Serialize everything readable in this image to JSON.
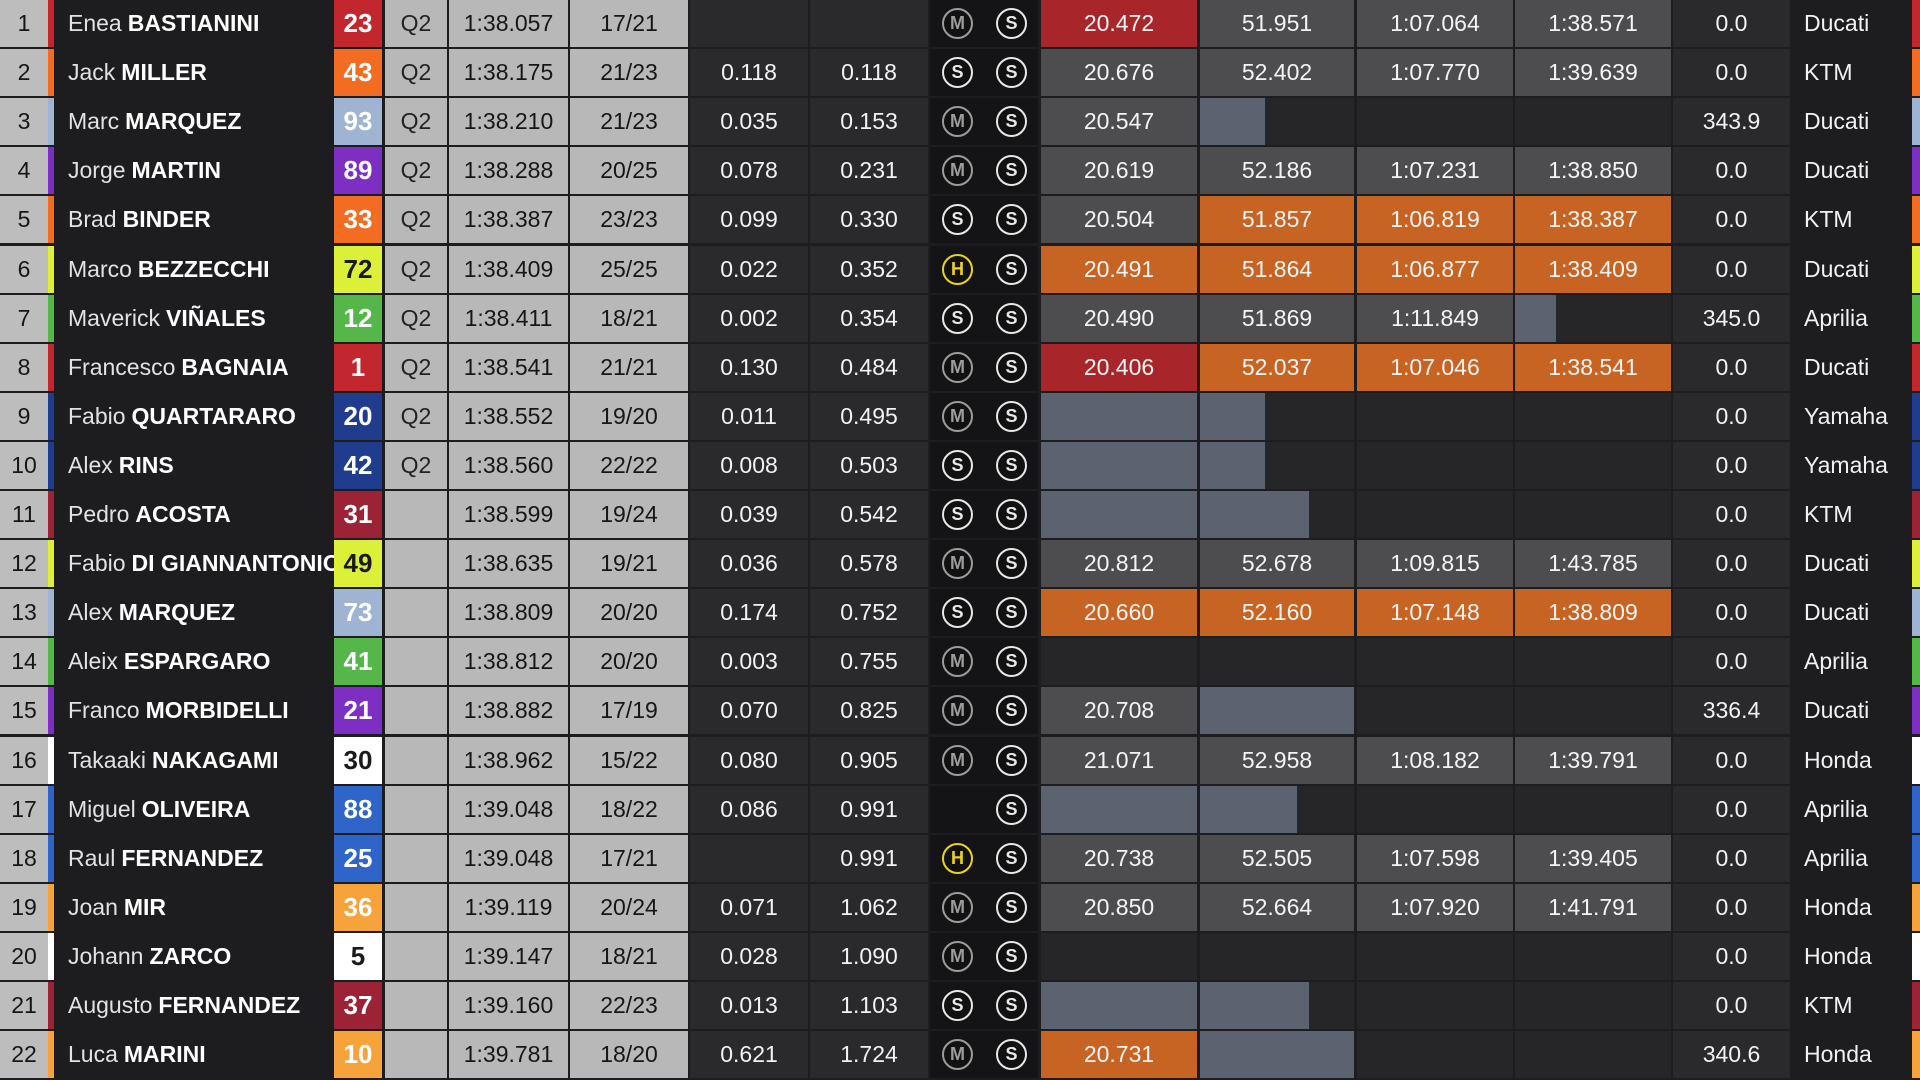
{
  "colors": {
    "best_overall_sector": "#a8262a",
    "personal_best_sector": "#c76423",
    "regular_sector": "#4d4d50",
    "in_progress_sector": "#5b6270"
  },
  "rows": [
    {
      "pos": "1",
      "first": "Enea",
      "last": "BASTIANINI",
      "number": "23",
      "num_bg": "#c1272d",
      "num_fg": "#ffffff",
      "team_color": "#c1272d",
      "q": "Q2",
      "best": "1:38.057",
      "laps": "17/21",
      "gap": "",
      "ldr": "",
      "tyre_front": "M",
      "tyre_rear": "S",
      "s1": {
        "v": "20.472",
        "k": "best-overall"
      },
      "s2": {
        "v": "51.951",
        "k": "regular"
      },
      "s3": {
        "v": "1:07.064",
        "k": "regular"
      },
      "s4": {
        "v": "1:38.571",
        "k": "regular"
      },
      "speed": "0.0",
      "team": "Ducati"
    },
    {
      "pos": "2",
      "first": "Jack",
      "last": "MILLER",
      "number": "43",
      "num_bg": "#f26d21",
      "num_fg": "#ffffff",
      "team_color": "#f26d21",
      "q": "Q2",
      "best": "1:38.175",
      "laps": "21/23",
      "gap": "0.118",
      "ldr": "0.118",
      "tyre_front": "S",
      "tyre_rear": "S",
      "s1": {
        "v": "20.676",
        "k": "regular"
      },
      "s2": {
        "v": "52.402",
        "k": "regular"
      },
      "s3": {
        "v": "1:07.770",
        "k": "regular"
      },
      "s4": {
        "v": "1:39.639",
        "k": "regular"
      },
      "speed": "0.0",
      "team": "KTM"
    },
    {
      "pos": "3",
      "first": "Marc",
      "last": "MARQUEZ",
      "number": "93",
      "num_bg": "#9fb4d3",
      "num_fg": "#ffffff",
      "team_color": "#9fb4d3",
      "q": "Q2",
      "best": "1:38.210",
      "laps": "21/23",
      "gap": "0.035",
      "ldr": "0.153",
      "tyre_front": "M",
      "tyre_rear": "S",
      "s1": {
        "v": "20.547",
        "k": "regular"
      },
      "s2": {
        "v": "",
        "k": "progress",
        "fill": 0.42
      },
      "s3": {
        "v": "",
        "k": "empty"
      },
      "s4": {
        "v": "",
        "k": "empty"
      },
      "speed": "343.9",
      "team": "Ducati"
    },
    {
      "pos": "4",
      "first": "Jorge",
      "last": "MARTIN",
      "number": "89",
      "num_bg": "#7d2fc4",
      "num_fg": "#ffffff",
      "team_color": "#7d2fc4",
      "q": "Q2",
      "best": "1:38.288",
      "laps": "20/25",
      "gap": "0.078",
      "ldr": "0.231",
      "tyre_front": "M",
      "tyre_rear": "S",
      "s1": {
        "v": "20.619",
        "k": "regular"
      },
      "s2": {
        "v": "52.186",
        "k": "regular"
      },
      "s3": {
        "v": "1:07.231",
        "k": "regular"
      },
      "s4": {
        "v": "1:38.850",
        "k": "regular"
      },
      "speed": "0.0",
      "team": "Ducati"
    },
    {
      "pos": "5",
      "first": "Brad",
      "last": "BINDER",
      "number": "33",
      "num_bg": "#f26d21",
      "num_fg": "#ffffff",
      "team_color": "#f26d21",
      "q": "Q2",
      "best": "1:38.387",
      "laps": "23/23",
      "gap": "0.099",
      "ldr": "0.330",
      "tyre_front": "S",
      "tyre_rear": "S",
      "s1": {
        "v": "20.504",
        "k": "regular"
      },
      "s2": {
        "v": "51.857",
        "k": "best-personal"
      },
      "s3": {
        "v": "1:06.819",
        "k": "best-personal"
      },
      "s4": {
        "v": "1:38.387",
        "k": "best-personal"
      },
      "speed": "0.0",
      "team": "KTM"
    },
    {
      "pos": "6",
      "first": "Marco",
      "last": "BEZZECCHI",
      "number": "72",
      "num_bg": "#dcf03a",
      "num_fg": "#1a1a1a",
      "team_color": "#dcf03a",
      "q": "Q2",
      "best": "1:38.409",
      "laps": "25/25",
      "gap": "0.022",
      "ldr": "0.352",
      "tyre_front": "H",
      "tyre_rear": "S",
      "s1": {
        "v": "20.491",
        "k": "best-personal"
      },
      "s2": {
        "v": "51.864",
        "k": "best-personal"
      },
      "s3": {
        "v": "1:06.877",
        "k": "best-personal"
      },
      "s4": {
        "v": "1:38.409",
        "k": "best-personal"
      },
      "speed": "0.0",
      "team": "Ducati"
    },
    {
      "pos": "7",
      "first": "Maverick",
      "last": "VIÑALES",
      "number": "12",
      "num_bg": "#55b74a",
      "num_fg": "#ffffff",
      "team_color": "#55b74a",
      "q": "Q2",
      "best": "1:38.411",
      "laps": "18/21",
      "gap": "0.002",
      "ldr": "0.354",
      "tyre_front": "S",
      "tyre_rear": "S",
      "s1": {
        "v": "20.490",
        "k": "regular"
      },
      "s2": {
        "v": "51.869",
        "k": "regular"
      },
      "s3": {
        "v": "1:11.849",
        "k": "regular"
      },
      "s4": {
        "v": "",
        "k": "progress",
        "fill": 0.26
      },
      "speed": "345.0",
      "team": "Aprilia"
    },
    {
      "pos": "8",
      "first": "Francesco",
      "last": "BAGNAIA",
      "number": "1",
      "num_bg": "#c1272d",
      "num_fg": "#ffffff",
      "team_color": "#c1272d",
      "q": "Q2",
      "best": "1:38.541",
      "laps": "21/21",
      "gap": "0.130",
      "ldr": "0.484",
      "tyre_front": "M",
      "tyre_rear": "S",
      "s1": {
        "v": "20.406",
        "k": "best-overall"
      },
      "s2": {
        "v": "52.037",
        "k": "best-personal"
      },
      "s3": {
        "v": "1:07.046",
        "k": "best-personal"
      },
      "s4": {
        "v": "1:38.541",
        "k": "best-personal"
      },
      "speed": "0.0",
      "team": "Ducati"
    },
    {
      "pos": "9",
      "first": "Fabio",
      "last": "QUARTARARO",
      "number": "20",
      "num_bg": "#1f3c8f",
      "num_fg": "#ffffff",
      "team_color": "#1f3c8f",
      "q": "Q2",
      "best": "1:38.552",
      "laps": "19/20",
      "gap": "0.011",
      "ldr": "0.495",
      "tyre_front": "M",
      "tyre_rear": "S",
      "s1": {
        "v": "",
        "k": "progress",
        "fill": 1.0
      },
      "s2": {
        "v": "",
        "k": "progress",
        "fill": 0.42
      },
      "s3": {
        "v": "",
        "k": "empty"
      },
      "s4": {
        "v": "",
        "k": "empty"
      },
      "speed": "0.0",
      "team": "Yamaha"
    },
    {
      "pos": "10",
      "first": "Alex",
      "last": "RINS",
      "number": "42",
      "num_bg": "#1f3c8f",
      "num_fg": "#ffffff",
      "team_color": "#1f3c8f",
      "q": "Q2",
      "best": "1:38.560",
      "laps": "22/22",
      "gap": "0.008",
      "ldr": "0.503",
      "tyre_front": "S",
      "tyre_rear": "S",
      "s1": {
        "v": "",
        "k": "progress",
        "fill": 1.0
      },
      "s2": {
        "v": "",
        "k": "progress",
        "fill": 0.42
      },
      "s3": {
        "v": "",
        "k": "empty"
      },
      "s4": {
        "v": "",
        "k": "empty"
      },
      "speed": "0.0",
      "team": "Yamaha"
    },
    {
      "pos": "11",
      "first": "Pedro",
      "last": "ACOSTA",
      "number": "31",
      "num_bg": "#9b2335",
      "num_fg": "#ffffff",
      "team_color": "#9b2335",
      "q": "",
      "best": "1:38.599",
      "laps": "19/24",
      "gap": "0.039",
      "ldr": "0.542",
      "tyre_front": "S",
      "tyre_rear": "S",
      "s1": {
        "v": "",
        "k": "progress",
        "fill": 1.0
      },
      "s2": {
        "v": "",
        "k": "progress",
        "fill": 0.71
      },
      "s3": {
        "v": "",
        "k": "empty"
      },
      "s4": {
        "v": "",
        "k": "empty"
      },
      "speed": "0.0",
      "team": "KTM"
    },
    {
      "pos": "12",
      "first": "Fabio",
      "last": "DI GIANNANTONIO",
      "number": "49",
      "num_bg": "#dcf03a",
      "num_fg": "#1a1a1a",
      "team_color": "#dcf03a",
      "q": "",
      "best": "1:38.635",
      "laps": "19/21",
      "gap": "0.036",
      "ldr": "0.578",
      "tyre_front": "M",
      "tyre_rear": "S",
      "s1": {
        "v": "20.812",
        "k": "regular"
      },
      "s2": {
        "v": "52.678",
        "k": "regular"
      },
      "s3": {
        "v": "1:09.815",
        "k": "regular"
      },
      "s4": {
        "v": "1:43.785",
        "k": "regular"
      },
      "speed": "0.0",
      "team": "Ducati"
    },
    {
      "pos": "13",
      "first": "Alex",
      "last": "MARQUEZ",
      "number": "73",
      "num_bg": "#9fb4d3",
      "num_fg": "#ffffff",
      "team_color": "#9fb4d3",
      "q": "",
      "best": "1:38.809",
      "laps": "20/20",
      "gap": "0.174",
      "ldr": "0.752",
      "tyre_front": "S",
      "tyre_rear": "S",
      "s1": {
        "v": "20.660",
        "k": "best-personal"
      },
      "s2": {
        "v": "52.160",
        "k": "best-personal"
      },
      "s3": {
        "v": "1:07.148",
        "k": "best-personal"
      },
      "s4": {
        "v": "1:38.809",
        "k": "best-personal"
      },
      "speed": "0.0",
      "team": "Ducati"
    },
    {
      "pos": "14",
      "first": "Aleix",
      "last": "ESPARGARO",
      "number": "41",
      "num_bg": "#55b74a",
      "num_fg": "#ffffff",
      "team_color": "#55b74a",
      "q": "",
      "best": "1:38.812",
      "laps": "20/20",
      "gap": "0.003",
      "ldr": "0.755",
      "tyre_front": "M",
      "tyre_rear": "S",
      "s1": {
        "v": "",
        "k": "empty"
      },
      "s2": {
        "v": "",
        "k": "empty"
      },
      "s3": {
        "v": "",
        "k": "empty"
      },
      "s4": {
        "v": "",
        "k": "empty"
      },
      "speed": "0.0",
      "team": "Aprilia"
    },
    {
      "pos": "15",
      "first": "Franco",
      "last": "MORBIDELLI",
      "number": "21",
      "num_bg": "#7d2fc4",
      "num_fg": "#ffffff",
      "team_color": "#7d2fc4",
      "q": "",
      "best": "1:38.882",
      "laps": "17/19",
      "gap": "0.070",
      "ldr": "0.825",
      "tyre_front": "M",
      "tyre_rear": "S",
      "s1": {
        "v": "20.708",
        "k": "regular"
      },
      "s2": {
        "v": "",
        "k": "progress",
        "fill": 1.0
      },
      "s3": {
        "v": "",
        "k": "empty"
      },
      "s4": {
        "v": "",
        "k": "empty"
      },
      "speed": "336.4",
      "team": "Ducati"
    },
    {
      "pos": "16",
      "first": "Takaaki",
      "last": "NAKAGAMI",
      "number": "30",
      "num_bg": "#ffffff",
      "num_fg": "#1a1a1a",
      "team_color": "#ffffff",
      "q": "",
      "best": "1:38.962",
      "laps": "15/22",
      "gap": "0.080",
      "ldr": "0.905",
      "tyre_front": "M",
      "tyre_rear": "S",
      "s1": {
        "v": "21.071",
        "k": "regular"
      },
      "s2": {
        "v": "52.958",
        "k": "regular"
      },
      "s3": {
        "v": "1:08.182",
        "k": "regular"
      },
      "s4": {
        "v": "1:39.791",
        "k": "regular"
      },
      "speed": "0.0",
      "team": "Honda"
    },
    {
      "pos": "17",
      "first": "Miguel",
      "last": "OLIVEIRA",
      "number": "88",
      "num_bg": "#2f64c8",
      "num_fg": "#ffffff",
      "team_color": "#2f64c8",
      "q": "",
      "best": "1:39.048",
      "laps": "18/22",
      "gap": "0.086",
      "ldr": "0.991",
      "tyre_front": "",
      "tyre_rear": "S",
      "s1": {
        "v": "",
        "k": "progress",
        "fill": 1.0
      },
      "s2": {
        "v": "",
        "k": "progress",
        "fill": 0.63
      },
      "s3": {
        "v": "",
        "k": "empty"
      },
      "s4": {
        "v": "",
        "k": "empty"
      },
      "speed": "0.0",
      "team": "Aprilia"
    },
    {
      "pos": "18",
      "first": "Raul",
      "last": "FERNANDEZ",
      "number": "25",
      "num_bg": "#2f64c8",
      "num_fg": "#ffffff",
      "team_color": "#2f64c8",
      "q": "",
      "best": "1:39.048",
      "laps": "17/21",
      "gap": "",
      "ldr": "0.991",
      "tyre_front": "H",
      "tyre_rear": "S",
      "s1": {
        "v": "20.738",
        "k": "regular"
      },
      "s2": {
        "v": "52.505",
        "k": "regular"
      },
      "s3": {
        "v": "1:07.598",
        "k": "regular"
      },
      "s4": {
        "v": "1:39.405",
        "k": "regular"
      },
      "speed": "0.0",
      "team": "Aprilia"
    },
    {
      "pos": "19",
      "first": "Joan",
      "last": "MIR",
      "number": "36",
      "num_bg": "#f5a33a",
      "num_fg": "#ffffff",
      "team_color": "#f5a33a",
      "q": "",
      "best": "1:39.119",
      "laps": "20/24",
      "gap": "0.071",
      "ldr": "1.062",
      "tyre_front": "M",
      "tyre_rear": "S",
      "s1": {
        "v": "20.850",
        "k": "regular"
      },
      "s2": {
        "v": "52.664",
        "k": "regular"
      },
      "s3": {
        "v": "1:07.920",
        "k": "regular"
      },
      "s4": {
        "v": "1:41.791",
        "k": "regular"
      },
      "speed": "0.0",
      "team": "Honda"
    },
    {
      "pos": "20",
      "first": "Johann",
      "last": "ZARCO",
      "number": "5",
      "num_bg": "#ffffff",
      "num_fg": "#1a1a1a",
      "team_color": "#ffffff",
      "q": "",
      "best": "1:39.147",
      "laps": "18/21",
      "gap": "0.028",
      "ldr": "1.090",
      "tyre_front": "M",
      "tyre_rear": "S",
      "s1": {
        "v": "",
        "k": "empty"
      },
      "s2": {
        "v": "",
        "k": "empty"
      },
      "s3": {
        "v": "",
        "k": "empty"
      },
      "s4": {
        "v": "",
        "k": "empty"
      },
      "speed": "0.0",
      "team": "Honda"
    },
    {
      "pos": "21",
      "first": "Augusto",
      "last": "FERNANDEZ",
      "number": "37",
      "num_bg": "#9b2335",
      "num_fg": "#ffffff",
      "team_color": "#9b2335",
      "q": "",
      "best": "1:39.160",
      "laps": "22/23",
      "gap": "0.013",
      "ldr": "1.103",
      "tyre_front": "S",
      "tyre_rear": "S",
      "s1": {
        "v": "",
        "k": "progress",
        "fill": 1.0
      },
      "s2": {
        "v": "",
        "k": "progress",
        "fill": 0.71
      },
      "s3": {
        "v": "",
        "k": "empty"
      },
      "s4": {
        "v": "",
        "k": "empty"
      },
      "speed": "0.0",
      "team": "KTM"
    },
    {
      "pos": "22",
      "first": "Luca",
      "last": "MARINI",
      "number": "10",
      "num_bg": "#f5a33a",
      "num_fg": "#ffffff",
      "team_color": "#f5a33a",
      "q": "",
      "best": "1:39.781",
      "laps": "18/20",
      "gap": "0.621",
      "ldr": "1.724",
      "tyre_front": "M",
      "tyre_rear": "S",
      "s1": {
        "v": "20.731",
        "k": "best-personal"
      },
      "s2": {
        "v": "",
        "k": "progress",
        "fill": 1.0
      },
      "s3": {
        "v": "",
        "k": "empty"
      },
      "s4": {
        "v": "",
        "k": "empty"
      },
      "speed": "340.6",
      "team": "Honda"
    }
  ]
}
